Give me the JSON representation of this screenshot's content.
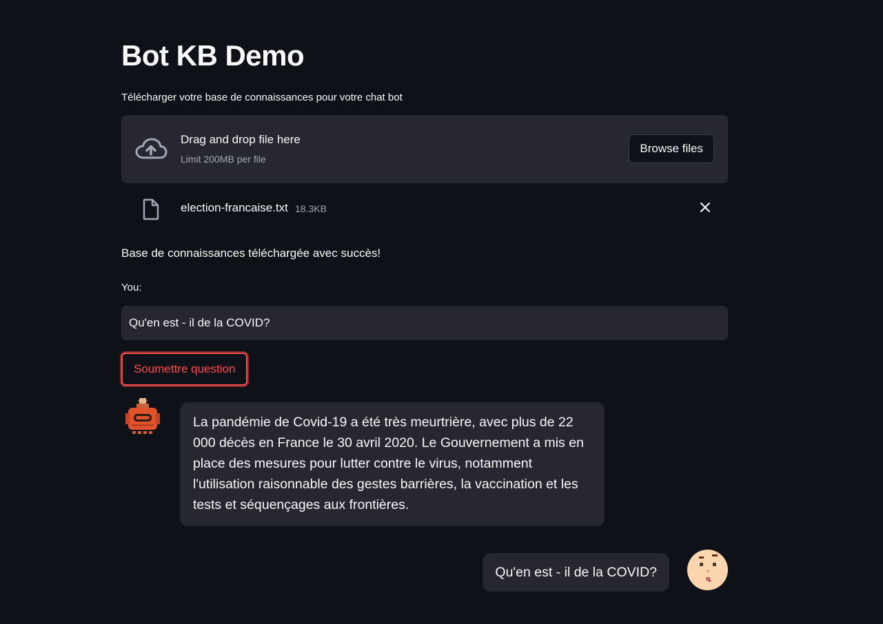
{
  "app": {
    "title": "Bot KB Demo"
  },
  "uploader": {
    "label": "Télécharger votre base de connaissances pour votre chat bot",
    "drop_text": "Drag and drop file here",
    "limit_text": "Limit 200MB per file",
    "browse_label": "Browse files",
    "upload_icon": "cloud-upload-icon"
  },
  "uploaded_file": {
    "name": "election-francaise.txt",
    "size": "18.3KB",
    "file_icon": "file-icon",
    "close_icon": "close-icon"
  },
  "status": {
    "success_message": "Base de connaissances téléchargée avec succès!"
  },
  "question": {
    "label": "You:",
    "value": "Qu'en est - il de la COVID?",
    "submit_label": "Soumettre question"
  },
  "chat": {
    "bot_message": "La pandémie de Covid-19 a été très meurtrière, avec plus de 22 000 décès en France le 30 avril 2020. Le Gouvernement a mis en place des mesures pour lutter contre le virus, notamment l'utilisation raisonnable des gestes barrières, la vaccination et les tests et séquençages aux frontières.",
    "user_message": "Qu'en est - il de la COVID?",
    "bot_avatar": "robot-avatar",
    "user_avatar": "user-face-avatar"
  },
  "colors": {
    "background": "#0e1117",
    "surface": "#262730",
    "text": "#fafafa",
    "muted": "#a3a8b8",
    "primary": "#ff4b4b"
  }
}
